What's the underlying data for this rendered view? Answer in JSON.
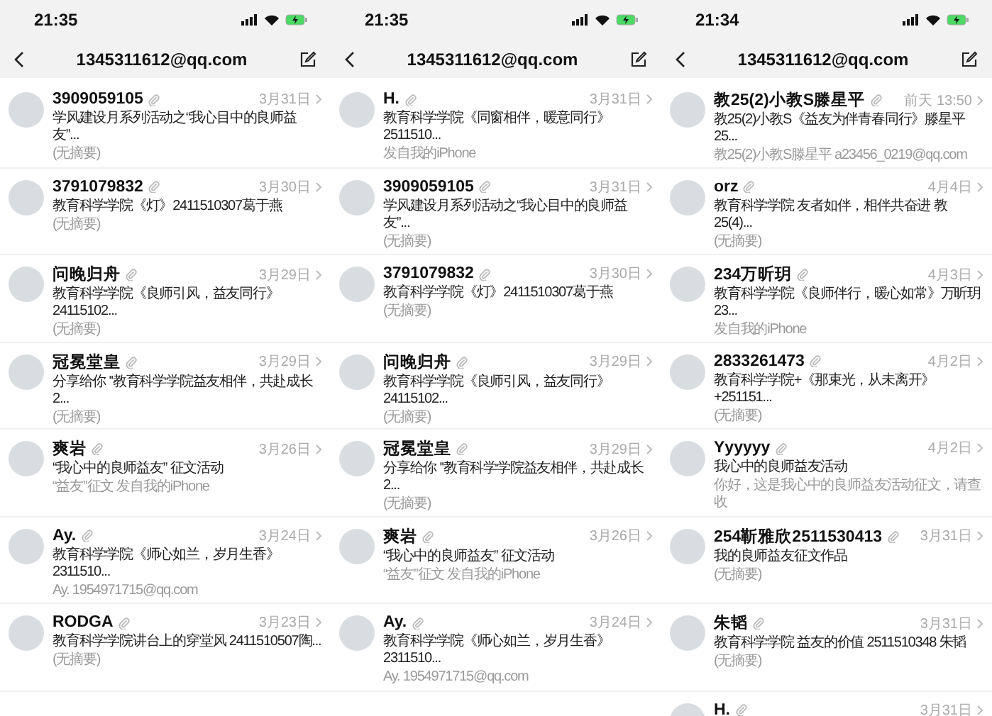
{
  "panels": [
    {
      "status_bar": {
        "time": "21:35"
      },
      "nav": {
        "title": "1345311612@qq.com"
      },
      "messages": [
        {
          "sender": "3909059105",
          "attachment": true,
          "date": "3月31日",
          "subject": "学风建设月系列活动之“我心目中的良师益友”...",
          "preview": "(无摘要)"
        },
        {
          "sender": "3791079832",
          "attachment": true,
          "date": "3月30日",
          "subject": "教育科学学院《灯》2411510307葛于燕",
          "preview": "(无摘要)"
        },
        {
          "sender": "问晚归舟",
          "attachment": true,
          "date": "3月29日",
          "subject": "教育科学学院《良师引风，益友同行》24115102...",
          "preview": "(无摘要)"
        },
        {
          "sender": "冠冕堂皇",
          "attachment": true,
          "date": "3月29日",
          "subject": "分享给你 ''教育科学学院益友相伴，共赴成长2...",
          "preview": "(无摘要)"
        },
        {
          "sender": "爽岩",
          "attachment": true,
          "date": "3月26日",
          "subject": "“我心中的良师益友” 征文活动",
          "preview": "“益友”征文  发自我的iPhone"
        },
        {
          "sender": "Ay.",
          "attachment": true,
          "date": "3月24日",
          "subject": "教育科学学院《师心如兰，岁月生香》2311510...",
          "preview": "Ay. 1954971715@qq.com"
        },
        {
          "sender": "RODGA",
          "attachment": true,
          "date": "3月23日",
          "subject": "教育科学学院讲台上的穿堂风 2411510507陶...",
          "preview": "(无摘要)"
        }
      ]
    },
    {
      "status_bar": {
        "time": "21:35"
      },
      "nav": {
        "title": "1345311612@qq.com"
      },
      "messages": [
        {
          "sender": "H.",
          "attachment": true,
          "date": "3月31日",
          "subject": "教育科学学院《同窗相伴，暖意同行》2511510...",
          "preview": "发自我的iPhone"
        },
        {
          "sender": "3909059105",
          "attachment": true,
          "date": "3月31日",
          "subject": "学风建设月系列活动之“我心目中的良师益友”...",
          "preview": "(无摘要)"
        },
        {
          "sender": "3791079832",
          "attachment": true,
          "date": "3月30日",
          "subject": "教育科学学院《灯》2411510307葛于燕",
          "preview": "(无摘要)"
        },
        {
          "sender": "问晚归舟",
          "attachment": true,
          "date": "3月29日",
          "subject": "教育科学学院《良师引风，益友同行》24115102...",
          "preview": "(无摘要)"
        },
        {
          "sender": "冠冕堂皇",
          "attachment": true,
          "date": "3月29日",
          "subject": "分享给你 ''教育科学学院益友相伴，共赴成长2...",
          "preview": "(无摘要)"
        },
        {
          "sender": "爽岩",
          "attachment": true,
          "date": "3月26日",
          "subject": "“我心中的良师益友” 征文活动",
          "preview": "“益友”征文  发自我的iPhone"
        },
        {
          "sender": "Ay.",
          "attachment": true,
          "date": "3月24日",
          "subject": "教育科学学院《师心如兰，岁月生香》2311510...",
          "preview": "Ay. 1954971715@qq.com"
        }
      ]
    },
    {
      "status_bar": {
        "time": "21:34"
      },
      "nav": {
        "title": "1345311612@qq.com"
      },
      "messages": [
        {
          "sender": "教25(2)小教S滕星平",
          "attachment": true,
          "date": "前天 13:50",
          "subject": "教25(2)小教S《益友为伴青春同行》滕星平 25...",
          "preview": "教25(2)小教S滕星平 a23456_0219@qq.com"
        },
        {
          "sender": "orz",
          "attachment": true,
          "date": "4月4日",
          "subject": "教育科学学院 友者如伴，相伴共奋进  教25(4)...",
          "preview": "(无摘要)"
        },
        {
          "sender": "234万昕玥",
          "attachment": true,
          "date": "4月3日",
          "subject": "教育科学学院《良师伴行，暖心如常》万昕玥23...",
          "preview": "发自我的iPhone"
        },
        {
          "sender": "2833261473",
          "attachment": true,
          "date": "4月2日",
          "subject": "教育科学学院+《那束光，从未离开》+251151...",
          "preview": "(无摘要)"
        },
        {
          "sender": "Yyyyyy",
          "attachment": true,
          "date": "4月2日",
          "subject": "我心中的良师益友活动",
          "preview": "你好，这是我心中的良师益友活动征文，请查收"
        },
        {
          "sender": "254靳雅欣2511530413",
          "attachment": true,
          "date": "3月31日",
          "subject": "我的良师益友征文作品",
          "preview": "(无摘要)"
        },
        {
          "sender": "朱韬",
          "attachment": true,
          "date": "3月31日",
          "subject": "教育科学学院 益友的价值 2511510348 朱韬",
          "preview": "(无摘要)"
        },
        {
          "sender": "H.",
          "attachment": true,
          "date": "3月31日"
        }
      ]
    }
  ]
}
